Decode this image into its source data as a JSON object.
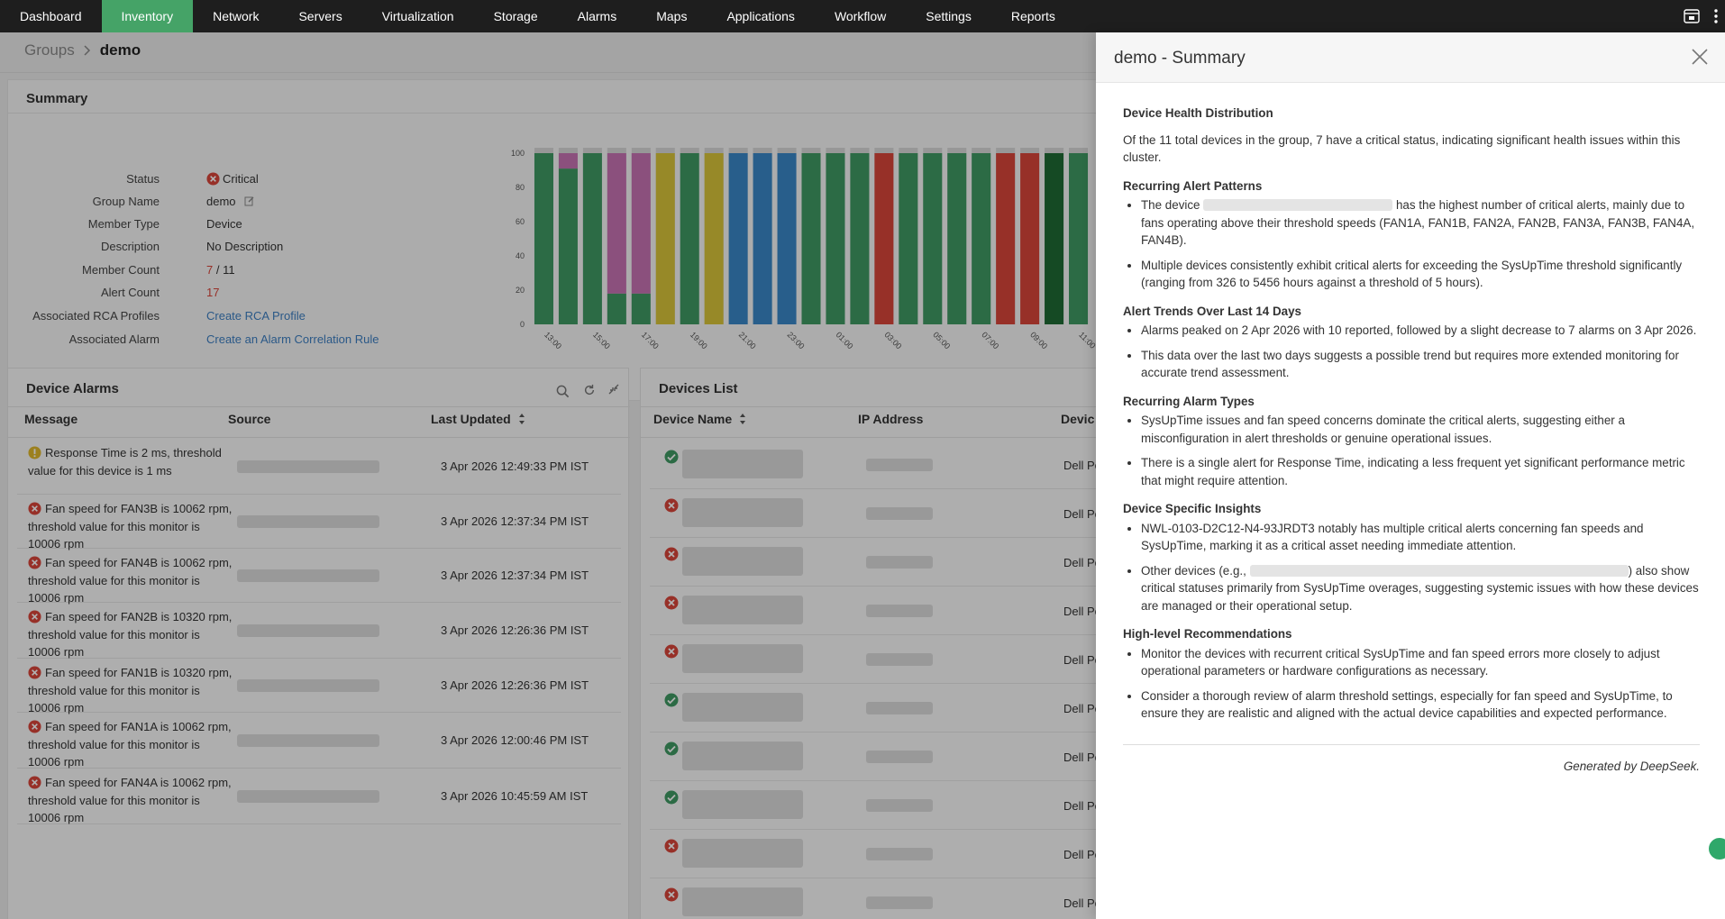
{
  "nav": {
    "items": [
      "Dashboard",
      "Inventory",
      "Network",
      "Servers",
      "Virtualization",
      "Storage",
      "Alarms",
      "Maps",
      "Applications",
      "Workflow",
      "Settings",
      "Reports"
    ],
    "active": "Inventory"
  },
  "breadcrumb": {
    "parent": "Groups",
    "current": "demo"
  },
  "summary": {
    "title": "Summary",
    "status_label": "Status",
    "status_value": "Critical",
    "group_name_label": "Group Name",
    "group_name_value": "demo",
    "member_type_label": "Member Type",
    "member_type_value": "Device",
    "description_label": "Description",
    "description_value": "No Description",
    "member_count_label": "Member Count",
    "member_count_value": "7",
    "member_count_total": "/ 11",
    "alert_count_label": "Alert Count",
    "alert_count_value": "17",
    "rca_label": "Associated RCA Profiles",
    "rca_value": "Create RCA Profile",
    "alarm_label": "Associated Alarm",
    "alarm_value": "Create an Alarm Correlation Rule"
  },
  "chart_data": {
    "type": "bar",
    "stacked": true,
    "y_ticks": [
      "100",
      "80",
      "60",
      "40",
      "20",
      "0"
    ],
    "ylim": [
      0,
      100
    ],
    "x_labels": [
      "13:00",
      "15:00",
      "17:00",
      "19:00",
      "21:00",
      "23:00",
      "01:00",
      "03:00",
      "05:00",
      "07:00",
      "09:00",
      "11:00"
    ],
    "colors": {
      "clear": "#3f9a64",
      "attention": "#c873b3",
      "trouble": "#d9c53a",
      "service_down": "#3a87c8",
      "critical": "#d9453a",
      "dark_green": "#1f6b34",
      "unknown": "#d8d8d8"
    },
    "bars": [
      [
        "clear"
      ],
      [
        "clear",
        "attention"
      ],
      [
        "clear"
      ],
      [
        "clear",
        "attention"
      ],
      [
        "clear",
        "attention"
      ],
      [
        "trouble"
      ],
      [
        "clear"
      ],
      [
        "trouble"
      ],
      [
        "service_down"
      ],
      [
        "service_down"
      ],
      [
        "service_down"
      ],
      [
        "clear"
      ],
      [
        "clear"
      ],
      [
        "clear"
      ],
      [
        "critical"
      ],
      [
        "clear"
      ],
      [
        "clear"
      ],
      [
        "clear"
      ],
      [
        "clear"
      ],
      [
        "critical"
      ],
      [
        "critical"
      ],
      [
        "dark_green"
      ],
      [
        "clear"
      ]
    ],
    "bar_values": [
      [
        100
      ],
      [
        91,
        9
      ],
      [
        100
      ],
      [
        18,
        82
      ],
      [
        18,
        82
      ],
      [
        100
      ],
      [
        100
      ],
      [
        100
      ],
      [
        100
      ],
      [
        100
      ],
      [
        100
      ],
      [
        100
      ],
      [
        100
      ],
      [
        100
      ],
      [
        100
      ],
      [
        100
      ],
      [
        100
      ],
      [
        100
      ],
      [
        100
      ],
      [
        100
      ],
      [
        100
      ],
      [
        100
      ],
      [
        100
      ]
    ]
  },
  "alarms": {
    "title": "Device Alarms",
    "col_message": "Message",
    "col_source": "Source",
    "col_updated": "Last Updated",
    "rows": [
      {
        "icon": "warning",
        "message": "Response Time is 2 ms, threshold value for this device is 1 ms",
        "time": "3 Apr 2026 12:49:33 PM IST"
      },
      {
        "icon": "critical",
        "message": "Fan speed for FAN3B is 10062 rpm, threshold value for this monitor is 10006 rpm",
        "time": "3 Apr 2026 12:37:34 PM IST"
      },
      {
        "icon": "critical",
        "message": "Fan speed for FAN4B is 10062 rpm, threshold value for this monitor is 10006 rpm",
        "time": "3 Apr 2026 12:37:34 PM IST"
      },
      {
        "icon": "critical",
        "message": "Fan speed for FAN2B is 10320 rpm, threshold value for this monitor is 10006 rpm",
        "time": "3 Apr 2026 12:26:36 PM IST"
      },
      {
        "icon": "critical",
        "message": "Fan speed for FAN1B is 10320 rpm, threshold value for this monitor is 10006 rpm",
        "time": "3 Apr 2026 12:26:36 PM IST"
      },
      {
        "icon": "critical",
        "message": "Fan speed for FAN1A is 10062 rpm, threshold value for this monitor is 10006 rpm",
        "time": "3 Apr 2026 12:00:46 PM IST"
      },
      {
        "icon": "critical",
        "message": "Fan speed for FAN4A is 10062 rpm, threshold value for this monitor is 10006 rpm",
        "time": "3 Apr 2026 10:45:59 AM IST"
      }
    ]
  },
  "devices": {
    "title": "Devices List",
    "col_name": "Device Name",
    "col_ip": "IP Address",
    "col_type": "Devic",
    "rows": [
      {
        "status": "clear",
        "type": "Dell Po"
      },
      {
        "status": "critical",
        "type": "Dell Po"
      },
      {
        "status": "critical",
        "type": "Dell Po"
      },
      {
        "status": "critical",
        "type": "Dell Po"
      },
      {
        "status": "critical",
        "type": "Dell Po"
      },
      {
        "status": "clear",
        "type": "Dell Po"
      },
      {
        "status": "clear",
        "type": "Dell Po"
      },
      {
        "status": "clear",
        "type": "Dell Po"
      },
      {
        "status": "critical",
        "type": "Dell Po"
      },
      {
        "status": "critical",
        "type": "Dell Po"
      }
    ]
  },
  "side": {
    "title": "demo - Summary",
    "h1": "Device Health Distribution",
    "p1": "Of the 11 total devices in the group, 7 have a critical status, indicating significant health issues within this cluster.",
    "h2": "Recurring Alert Patterns",
    "h2_li1_a": "The device",
    "h2_li1_b": "has the highest number of critical alerts, mainly due to fans operating above their threshold speeds (FAN1A, FAN1B, FAN2A, FAN2B, FAN3A, FAN3B, FAN4A, FAN4B).",
    "h2_li2": "Multiple devices consistently exhibit critical alerts for exceeding the SysUpTime threshold significantly (ranging from 326 to 5456 hours against a threshold of 5 hours).",
    "h3": "Alert Trends Over Last 14 Days",
    "h3_li1": "Alarms peaked on 2 Apr 2026 with 10 reported, followed by a slight decrease to 7 alarms on 3 Apr 2026.",
    "h3_li2": "This data over the last two days suggests a possible trend but requires more extended monitoring for accurate trend assessment.",
    "h4": "Recurring Alarm Types",
    "h4_li1": "SysUpTime issues and fan speed concerns dominate the critical alerts, suggesting either a misconfiguration in alert thresholds or genuine operational issues.",
    "h4_li2": "There is a single alert for Response Time, indicating a less frequent yet significant performance metric that might require attention.",
    "h5": "Device Specific Insights",
    "h5_li1": "NWL-0103-D2C12-N4-93JRDT3 notably has multiple critical alerts concerning fan speeds and SysUpTime, marking it as a critical asset needing immediate attention.",
    "h5_li2_a": "Other devices (e.g.,",
    "h5_li2_b": ") also show critical statuses primarily from SysUpTime overages, suggesting systemic issues with how these devices are managed or their operational setup.",
    "h6": "High-level Recommendations",
    "h6_li1": "Monitor the devices with recurrent critical SysUpTime and fan speed errors more closely to adjust operational parameters or hardware configurations as necessary.",
    "h6_li2": "Consider a thorough review of alarm threshold settings, especially for fan speed and SysUpTime, to ensure they are realistic and aligned with the actual device capabilities and expected performance.",
    "footer": "Generated by DeepSeek."
  }
}
